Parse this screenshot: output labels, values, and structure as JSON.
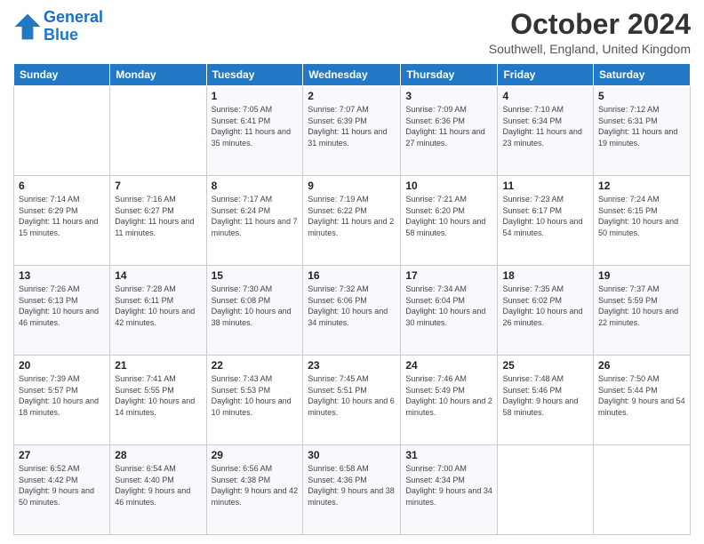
{
  "header": {
    "logo_line1": "General",
    "logo_line2": "Blue",
    "month_title": "October 2024",
    "location": "Southwell, England, United Kingdom"
  },
  "weekdays": [
    "Sunday",
    "Monday",
    "Tuesday",
    "Wednesday",
    "Thursday",
    "Friday",
    "Saturday"
  ],
  "weeks": [
    [
      {
        "day": "",
        "info": ""
      },
      {
        "day": "",
        "info": ""
      },
      {
        "day": "1",
        "info": "Sunrise: 7:05 AM\nSunset: 6:41 PM\nDaylight: 11 hours and 35 minutes."
      },
      {
        "day": "2",
        "info": "Sunrise: 7:07 AM\nSunset: 6:39 PM\nDaylight: 11 hours and 31 minutes."
      },
      {
        "day": "3",
        "info": "Sunrise: 7:09 AM\nSunset: 6:36 PM\nDaylight: 11 hours and 27 minutes."
      },
      {
        "day": "4",
        "info": "Sunrise: 7:10 AM\nSunset: 6:34 PM\nDaylight: 11 hours and 23 minutes."
      },
      {
        "day": "5",
        "info": "Sunrise: 7:12 AM\nSunset: 6:31 PM\nDaylight: 11 hours and 19 minutes."
      }
    ],
    [
      {
        "day": "6",
        "info": "Sunrise: 7:14 AM\nSunset: 6:29 PM\nDaylight: 11 hours and 15 minutes."
      },
      {
        "day": "7",
        "info": "Sunrise: 7:16 AM\nSunset: 6:27 PM\nDaylight: 11 hours and 11 minutes."
      },
      {
        "day": "8",
        "info": "Sunrise: 7:17 AM\nSunset: 6:24 PM\nDaylight: 11 hours and 7 minutes."
      },
      {
        "day": "9",
        "info": "Sunrise: 7:19 AM\nSunset: 6:22 PM\nDaylight: 11 hours and 2 minutes."
      },
      {
        "day": "10",
        "info": "Sunrise: 7:21 AM\nSunset: 6:20 PM\nDaylight: 10 hours and 58 minutes."
      },
      {
        "day": "11",
        "info": "Sunrise: 7:23 AM\nSunset: 6:17 PM\nDaylight: 10 hours and 54 minutes."
      },
      {
        "day": "12",
        "info": "Sunrise: 7:24 AM\nSunset: 6:15 PM\nDaylight: 10 hours and 50 minutes."
      }
    ],
    [
      {
        "day": "13",
        "info": "Sunrise: 7:26 AM\nSunset: 6:13 PM\nDaylight: 10 hours and 46 minutes."
      },
      {
        "day": "14",
        "info": "Sunrise: 7:28 AM\nSunset: 6:11 PM\nDaylight: 10 hours and 42 minutes."
      },
      {
        "day": "15",
        "info": "Sunrise: 7:30 AM\nSunset: 6:08 PM\nDaylight: 10 hours and 38 minutes."
      },
      {
        "day": "16",
        "info": "Sunrise: 7:32 AM\nSunset: 6:06 PM\nDaylight: 10 hours and 34 minutes."
      },
      {
        "day": "17",
        "info": "Sunrise: 7:34 AM\nSunset: 6:04 PM\nDaylight: 10 hours and 30 minutes."
      },
      {
        "day": "18",
        "info": "Sunrise: 7:35 AM\nSunset: 6:02 PM\nDaylight: 10 hours and 26 minutes."
      },
      {
        "day": "19",
        "info": "Sunrise: 7:37 AM\nSunset: 5:59 PM\nDaylight: 10 hours and 22 minutes."
      }
    ],
    [
      {
        "day": "20",
        "info": "Sunrise: 7:39 AM\nSunset: 5:57 PM\nDaylight: 10 hours and 18 minutes."
      },
      {
        "day": "21",
        "info": "Sunrise: 7:41 AM\nSunset: 5:55 PM\nDaylight: 10 hours and 14 minutes."
      },
      {
        "day": "22",
        "info": "Sunrise: 7:43 AM\nSunset: 5:53 PM\nDaylight: 10 hours and 10 minutes."
      },
      {
        "day": "23",
        "info": "Sunrise: 7:45 AM\nSunset: 5:51 PM\nDaylight: 10 hours and 6 minutes."
      },
      {
        "day": "24",
        "info": "Sunrise: 7:46 AM\nSunset: 5:49 PM\nDaylight: 10 hours and 2 minutes."
      },
      {
        "day": "25",
        "info": "Sunrise: 7:48 AM\nSunset: 5:46 PM\nDaylight: 9 hours and 58 minutes."
      },
      {
        "day": "26",
        "info": "Sunrise: 7:50 AM\nSunset: 5:44 PM\nDaylight: 9 hours and 54 minutes."
      }
    ],
    [
      {
        "day": "27",
        "info": "Sunrise: 6:52 AM\nSunset: 4:42 PM\nDaylight: 9 hours and 50 minutes."
      },
      {
        "day": "28",
        "info": "Sunrise: 6:54 AM\nSunset: 4:40 PM\nDaylight: 9 hours and 46 minutes."
      },
      {
        "day": "29",
        "info": "Sunrise: 6:56 AM\nSunset: 4:38 PM\nDaylight: 9 hours and 42 minutes."
      },
      {
        "day": "30",
        "info": "Sunrise: 6:58 AM\nSunset: 4:36 PM\nDaylight: 9 hours and 38 minutes."
      },
      {
        "day": "31",
        "info": "Sunrise: 7:00 AM\nSunset: 4:34 PM\nDaylight: 9 hours and 34 minutes."
      },
      {
        "day": "",
        "info": ""
      },
      {
        "day": "",
        "info": ""
      }
    ]
  ]
}
